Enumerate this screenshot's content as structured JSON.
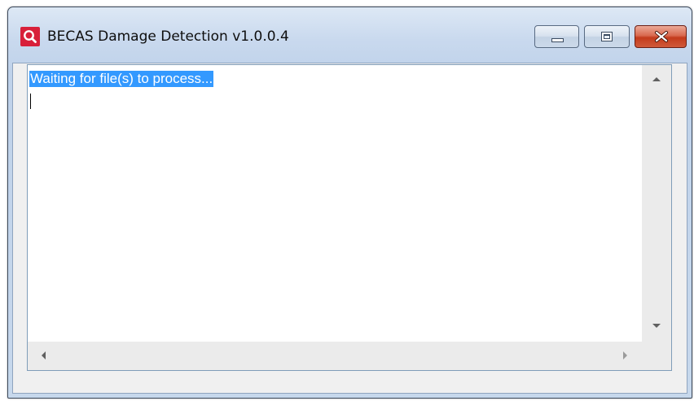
{
  "window": {
    "title": "BECAS Damage Detection v1.0.0.4",
    "icon": "magnifier-icon",
    "accent_color": "#d8203a",
    "controls": {
      "minimize": "minimize-icon",
      "maximize": "maximize-icon",
      "close": "close-icon"
    }
  },
  "log": {
    "text": "Waiting for file(s) to process...",
    "selection_color": "#3399ff"
  }
}
